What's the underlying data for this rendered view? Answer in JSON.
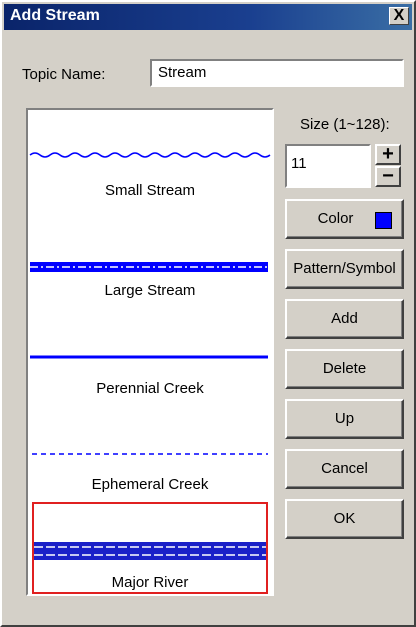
{
  "dialog": {
    "title": "Add Stream",
    "close_glyph": "X"
  },
  "topic": {
    "label": "Topic Name:",
    "value": "Stream"
  },
  "preview": {
    "items": [
      {
        "label": "Small Stream"
      },
      {
        "label": "Large Stream"
      },
      {
        "label": "Perennial Creek"
      },
      {
        "label": "Ephemeral Creek"
      },
      {
        "label": "Major River"
      }
    ],
    "selected": "Major River"
  },
  "size": {
    "label": "Size (1~128):",
    "value": "11",
    "increment_glyph": "+",
    "decrement_glyph": "−"
  },
  "buttons": {
    "color": "Color",
    "pattern_symbol": "Pattern/Symbol",
    "add": "Add",
    "delete": "Delete",
    "up": "Up",
    "cancel": "Cancel",
    "ok": "OK"
  },
  "colors": {
    "line_blue": "#0000ff",
    "selection_border": "#e02020",
    "title_bar": "#0a246a"
  }
}
